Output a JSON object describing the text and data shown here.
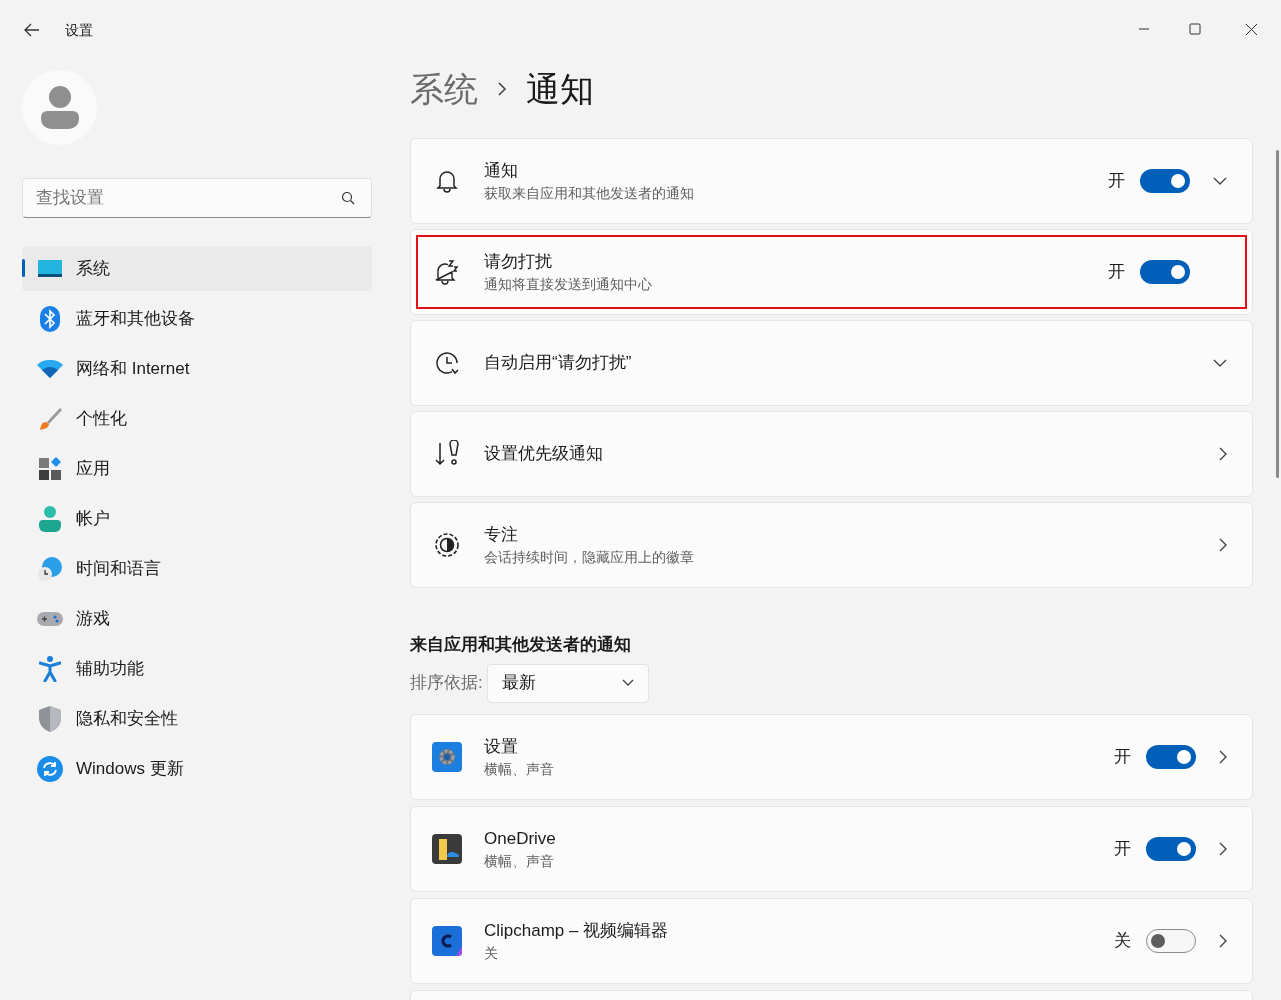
{
  "window": {
    "title": "设置"
  },
  "sidebar": {
    "search": {
      "placeholder": "查找设置"
    },
    "items": [
      {
        "label": "系统",
        "selected": true
      },
      {
        "label": "蓝牙和其他设备",
        "selected": false
      },
      {
        "label": "网络和 Internet",
        "selected": false
      },
      {
        "label": "个性化",
        "selected": false
      },
      {
        "label": "应用",
        "selected": false
      },
      {
        "label": "帐户",
        "selected": false
      },
      {
        "label": "时间和语言",
        "selected": false
      },
      {
        "label": "游戏",
        "selected": false
      },
      {
        "label": "辅助功能",
        "selected": false
      },
      {
        "label": "隐私和安全性",
        "selected": false
      },
      {
        "label": "Windows 更新",
        "selected": false
      }
    ]
  },
  "breadcrumb": [
    "系统",
    "通知"
  ],
  "cards": [
    {
      "kind": "expand",
      "title": "通知",
      "subtitle": "获取来自应用和其他发送者的通知",
      "toggle": {
        "label": "开",
        "on": true
      },
      "highlighted": false
    },
    {
      "kind": "plain",
      "title": "请勿打扰",
      "subtitle": "通知将直接发送到通知中心",
      "toggle": {
        "label": "开",
        "on": true
      },
      "highlighted": true
    },
    {
      "kind": "expand",
      "title": "自动启用“请勿打扰”",
      "highlighted": false
    },
    {
      "kind": "navigate",
      "title": "设置优先级通知",
      "highlighted": false
    },
    {
      "kind": "navigate",
      "title": "专注",
      "subtitle": "会话持续时间，隐藏应用上的徽章",
      "highlighted": false
    }
  ],
  "apps_section": {
    "heading": "来自应用和其他发送者的通知",
    "sort_label": "排序依据:",
    "sort_value": "最新",
    "apps": [
      {
        "name": "设置",
        "subtitle": "横幅、声音",
        "toggle": {
          "label": "开",
          "on": true
        }
      },
      {
        "name": "OneDrive",
        "subtitle": "横幅、声音",
        "toggle": {
          "label": "开",
          "on": true
        }
      },
      {
        "name": "Clipchamp – 视频编辑器",
        "subtitle": "关",
        "toggle": {
          "label": "关",
          "on": false
        }
      }
    ]
  }
}
